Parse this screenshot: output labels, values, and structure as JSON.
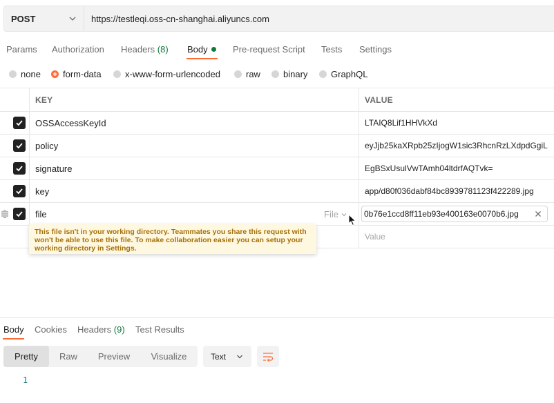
{
  "request": {
    "method": "POST",
    "url": "https://testleqi.oss-cn-shanghai.aliyuncs.com"
  },
  "request_tabs": [
    {
      "label": "Params"
    },
    {
      "label": "Authorization"
    },
    {
      "label": "Headers",
      "count": "(8)"
    },
    {
      "label": "Body"
    },
    {
      "label": "Pre-request Script"
    },
    {
      "label": "Tests"
    },
    {
      "label": "Settings"
    }
  ],
  "body_types": [
    {
      "label": "none"
    },
    {
      "label": "form-data"
    },
    {
      "label": "x-www-form-urlencoded"
    },
    {
      "label": "raw"
    },
    {
      "label": "binary"
    },
    {
      "label": "GraphQL"
    }
  ],
  "table": {
    "key_header": "KEY",
    "value_header": "VALUE",
    "rows": [
      {
        "key": "OSSAccessKeyId",
        "value": "LTAIQ8Lif1HHVkXd"
      },
      {
        "key": "policy",
        "value": "eyJjb25kaXRpb25zIjogW1sic3RhcnRzLXdpdGgiL"
      },
      {
        "key": "signature",
        "value": "EgBSxUsulVwTAmh04ltdrfAQTvk="
      },
      {
        "key": "key",
        "value": "app/d80f036dabf84bc8939781123f422289.jpg"
      },
      {
        "key": "file",
        "type": "File",
        "value": "0b76e1ccd8ff11eb93e400163e0070b6.jpg"
      }
    ],
    "new_value_placeholder": "Value"
  },
  "tooltip": "This file isn't in your working directory. Teammates you share this request with won't be able to use this file. To make collaboration easier you can setup your working directory in Settings.",
  "response": {
    "tabs": [
      {
        "label": "Body"
      },
      {
        "label": "Cookies"
      },
      {
        "label": "Headers",
        "count": "(9)"
      },
      {
        "label": "Test Results"
      }
    ],
    "view_modes": [
      "Pretty",
      "Raw",
      "Preview",
      "Visualize"
    ],
    "format": "Text",
    "line_number": "1"
  },
  "colors": {
    "accent": "#ff6c37",
    "success": "#0f7b3b",
    "warning_text": "#a6700a",
    "warning_bg": "#fff8e1"
  }
}
